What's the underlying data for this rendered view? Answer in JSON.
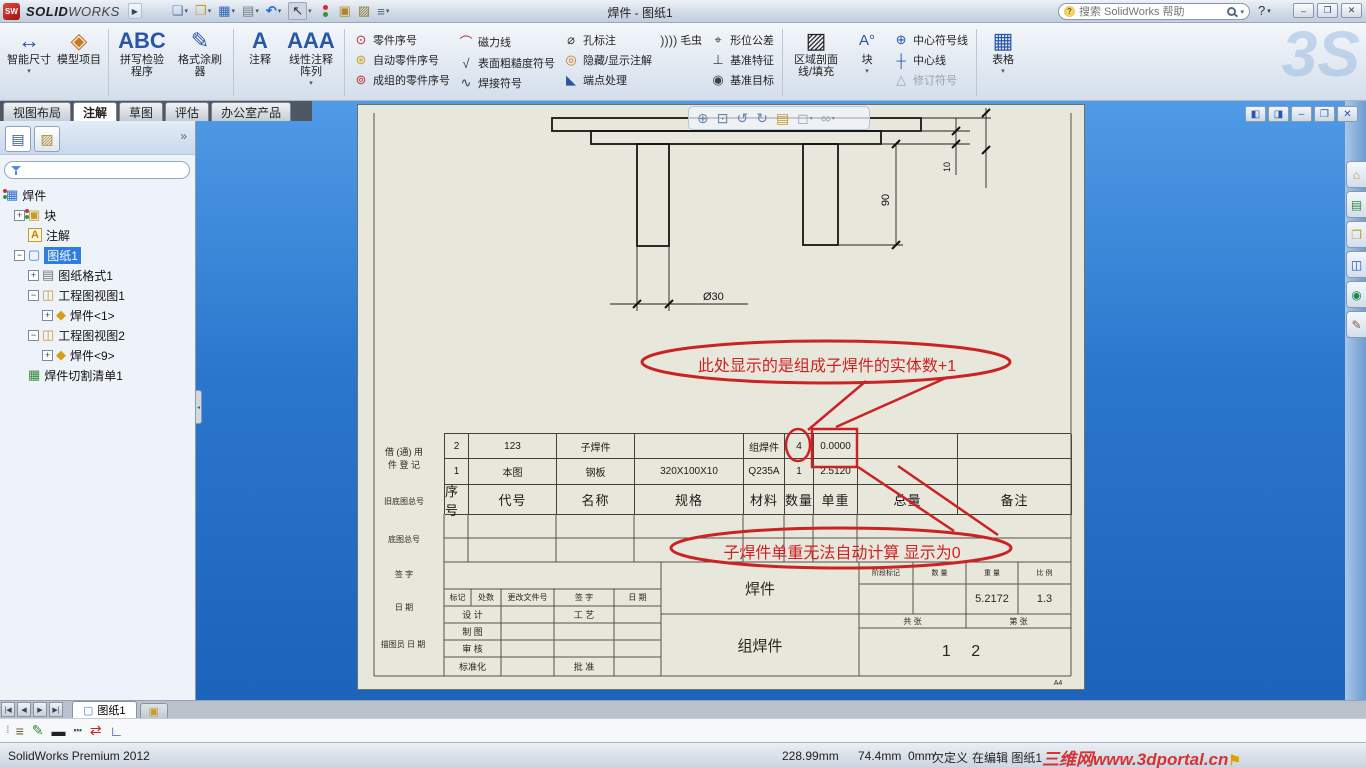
{
  "title_bar": {
    "logo": "SW",
    "app_bold": "SOLID",
    "app_light": "WORKS",
    "doc_title": "焊件 - 图纸1",
    "search_placeholder": "搜索 SolidWorks 帮助"
  },
  "ribbon": {
    "watermark": "3S",
    "big1": "智能尺寸",
    "big2": "模型项目",
    "big3": "拼写检验程序",
    "big4": "格式涂刷器",
    "big5": "注释",
    "big6": "线性注释阵列",
    "colA": [
      "零件序号",
      "自动零件序号",
      "成组的零件序号"
    ],
    "colB": [
      "磁力线",
      "表面粗糙度符号",
      "焊接符号"
    ],
    "colC": [
      "孔标注",
      "隐藏/显示注解",
      "端点处理"
    ],
    "colD": [
      "毛虫"
    ],
    "colE": [
      "形位公差",
      "基准特征",
      "基准目标"
    ],
    "big7": "区域剖面线/填充",
    "big8": "块",
    "colF": [
      "中心符号线",
      "中心线",
      "修订符号"
    ],
    "big9": "表格"
  },
  "command_tabs": {
    "t0": "视图布局",
    "t1": "注解",
    "t2": "草图",
    "t3": "评估",
    "t4": "办公室产品"
  },
  "tree": {
    "items": [
      {
        "label": "焊件"
      },
      {
        "label": "块"
      },
      {
        "label": "注解"
      },
      {
        "label": "图纸1"
      },
      {
        "label": "图纸格式1"
      },
      {
        "label": "工程图视图1"
      },
      {
        "label": "焊件<1>"
      },
      {
        "label": "工程图视图2"
      },
      {
        "label": "焊件<9>"
      },
      {
        "label": "焊件切割清单1"
      }
    ]
  },
  "drawing": {
    "dims": {
      "thickness": "10",
      "height": "90",
      "diameter": "Ø30"
    },
    "bom": {
      "headers": [
        "序号",
        "代号",
        "名称",
        "规格",
        "材料",
        "数量",
        "单重",
        "总量",
        "备注"
      ],
      "row1": [
        "2",
        "123",
        "子焊件",
        "",
        "组焊件",
        "4",
        "0.0000",
        "",
        ""
      ],
      "row2": [
        "1",
        "本图",
        "钢板",
        "320X100X10",
        "Q235A",
        "1",
        "2.5120",
        "",
        ""
      ]
    },
    "notes": {
      "n1": "此处显示的是组成子焊件的实体数+1",
      "n2": "子焊件单重无法自动计算 显示为0"
    },
    "tb": {
      "borrow": "借 (通) 用\n件 登 记",
      "old_no": "旧底图总号",
      "base_no": "底图总号",
      "sign": "签  字",
      "date": "日  期",
      "tracer": "描图员  日 期",
      "rev0": "标记",
      "rev1": "处数",
      "rev2": "更改文件号",
      "rev3": "签 字",
      "rev4": "日 期",
      "design": "设 计",
      "craft": "工 艺",
      "draft": "制 图",
      "check": "审 核",
      "std": "标准化",
      "approve": "批 准",
      "part": "焊件",
      "assembly": "组焊件",
      "stat0": "阶段标记",
      "stat1": "数 量",
      "stat2": "重 量",
      "stat3": "比 例",
      "weight": "5.2172",
      "scale": "1.3",
      "total_sheets": "共  张",
      "sheet_no": "第  张",
      "number": "1 2",
      "size": "A4"
    }
  },
  "sheet_tabs": {
    "active": "图纸1"
  },
  "status": {
    "product": "SolidWorks Premium 2012",
    "x": "228.99mm",
    "y": "74.4mm",
    "z": "0mm",
    "state": "欠定义",
    "editing": "在编辑 图纸1",
    "watermark": "三维网www.3dportal.cn"
  },
  "colors": {
    "viewport_blue": "#2b77cd",
    "annotation_red": "#cc2222",
    "selection_blue": "#2f7de0",
    "sheet_beige": "#e8e7dc"
  },
  "icons": {
    "dropdown": "▾",
    "plus": "+",
    "minus": "−",
    "menu_arrow": "▶",
    "chevron": "»",
    "new_doc": "❏",
    "open_doc": "❐",
    "save_doc": "▦",
    "print_doc": "▤",
    "undo": "↶",
    "select_cursor": "↖",
    "note_props1": "▣",
    "note_props2": "▨",
    "options_list": "≡",
    "help": "?",
    "win_min": "‒",
    "win_restore": "❐",
    "win_close": "✕",
    "fm_tab": "▤",
    "pm_tab": "▨",
    "smart_dimension": "↔",
    "model_items": "◈",
    "spell": "ABC",
    "format_painter": "✎",
    "note": "A",
    "linear_note": "AAA",
    "balloon": "⊙",
    "auto_balloon": "⊛",
    "group_balloon": "⊚",
    "magnetic": "⌒",
    "surface": "√",
    "weld": "∿",
    "hole": "⌀",
    "hideshow": "◎",
    "endpoint": "◣",
    "caterpillar": "))))",
    "gtol": "⌖",
    "datum_feature": "⊥",
    "datum_target": "◉",
    "hatch": "▨",
    "block": "A°",
    "center_mark": "⊕",
    "centerline": "┼",
    "revision": "△",
    "table": "▦",
    "hs_zoom_fit": "⊕",
    "hs_zoom_area": "⊡",
    "hs_prev": "↺",
    "hs_rotate": "↻",
    "hs_sheet": "▤",
    "hs_view": "◻",
    "hs_glasses": "∞",
    "dw_pane1": "◧",
    "dw_pane2": "◨",
    "tree_weldment": "▦",
    "tree_blocks": "▣",
    "tree_annotations": "A",
    "tree_sheet": "▢",
    "tree_sheet_format": "▤",
    "tree_view": "◫",
    "tree_part": "◆",
    "tree_cutlist": "▦",
    "tp_home": "⌂",
    "tp_library": "▤",
    "tp_explorer": "❐",
    "tp_palette": "◫",
    "tp_appearance": "◉",
    "tp_props": "✎",
    "nav_first": "|◀",
    "nav_prev": "◀",
    "nav_next": "▶",
    "nav_last": "▶|",
    "sheet_page": "▢",
    "add_sheet": "▣",
    "bb_layers": "≡",
    "bb_color": "✎",
    "bb_thick": "▬",
    "bb_style": "┅",
    "bb_swap": "⇄",
    "bb_corner": "∟",
    "flag": "⚑"
  }
}
